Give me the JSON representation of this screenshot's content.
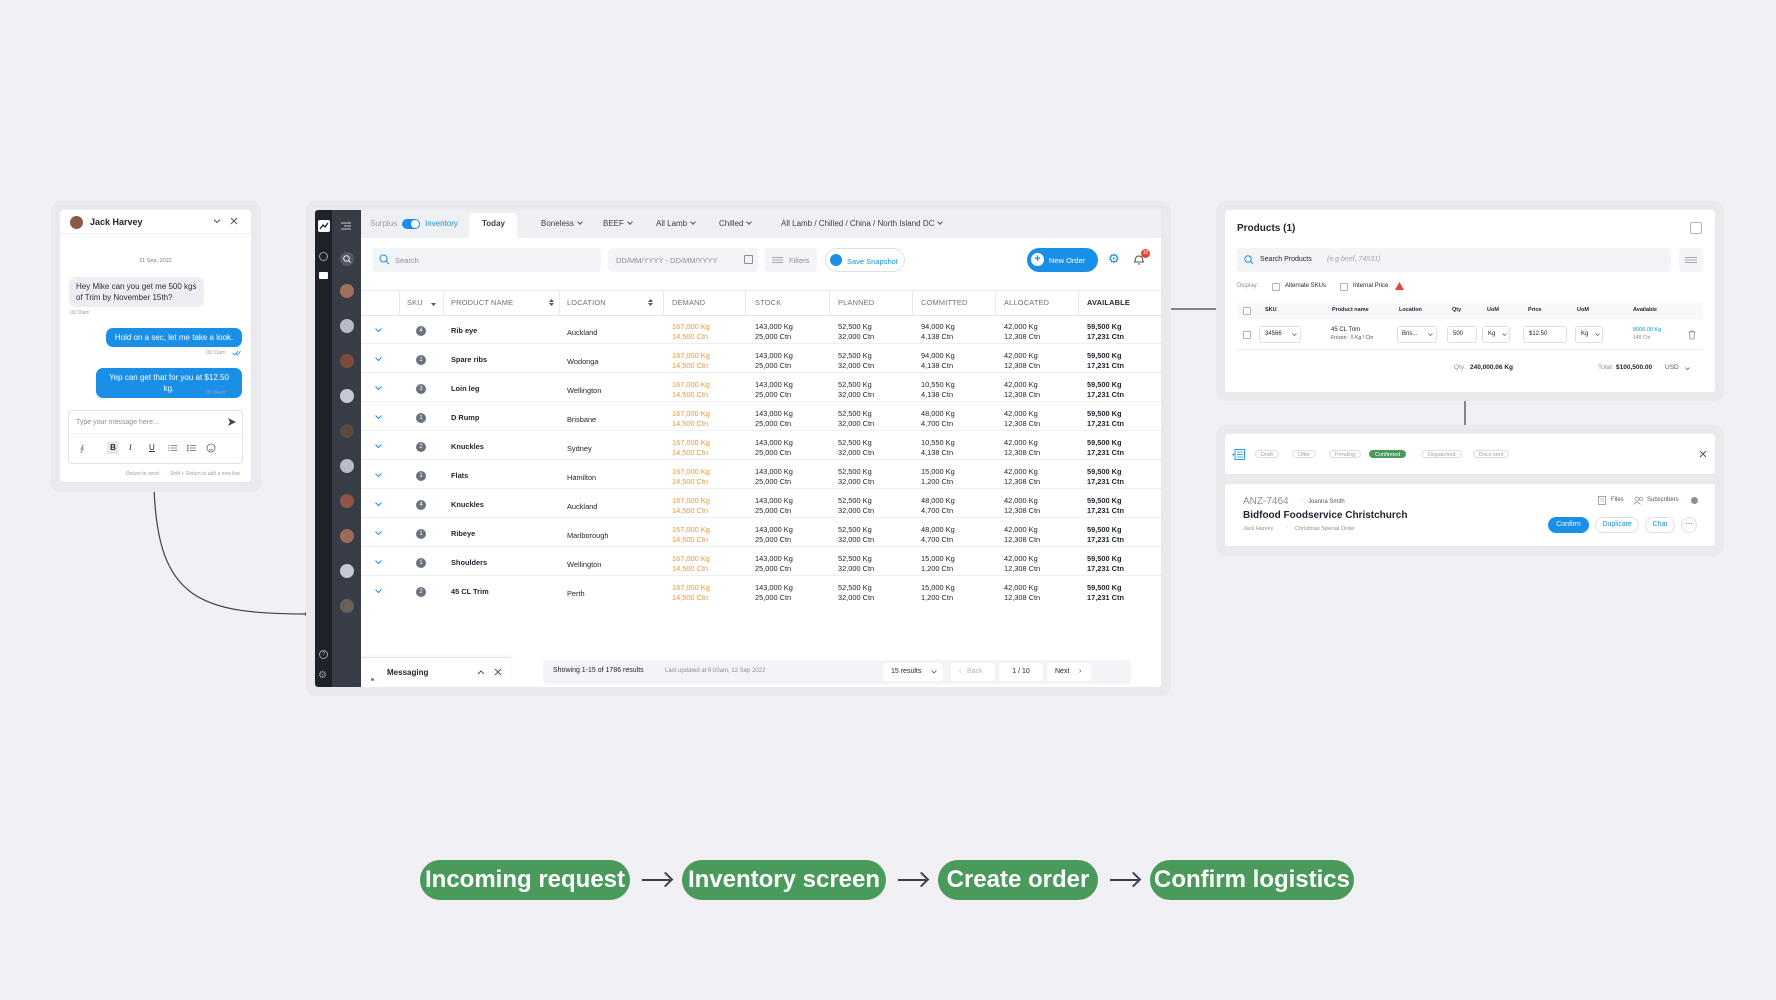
{
  "chat": {
    "name": "Jack Harvey",
    "date": "21 Sep, 2022",
    "messages": [
      {
        "from": "in",
        "text": "Hey Mike can you get me 500 kgs of Trim by November 15th?",
        "time": "09:30am"
      },
      {
        "from": "out",
        "text": "Hold on a sec, let me take a look.",
        "time": "09:31am"
      },
      {
        "from": "out",
        "text": "Yep can get that for you at $12.50 kg.",
        "time": "09:34am"
      }
    ],
    "input_placeholder": "Type your message here...",
    "hint_return": "Return to send",
    "hint_shift": "Shift + Return to add a new line"
  },
  "tabs": {
    "surplus": "Surplus",
    "inventory": "Inventory",
    "today": "Today",
    "filters": [
      "Boneless",
      "BEEF",
      "All Lamb",
      "Chilled",
      "All Lamb / Chilled / China / North Island DC"
    ]
  },
  "toolbar": {
    "search_placeholder": "Search",
    "date_placeholder": "DD/MM/YYYY - DD/MM/YYYY",
    "filters_label": "Filters",
    "save_snapshot": "Save Snapshot",
    "new_order": "New Order",
    "notification_count": "10"
  },
  "table": {
    "columns": [
      "SKU",
      "PRODUCT NAME",
      "LOCATION",
      "DEMAND",
      "STOCK",
      "PLANNED",
      "COMMITTED",
      "ALLOCATED",
      "AVAILABLE"
    ],
    "rows": [
      {
        "sku": "4",
        "name": "Rib eye",
        "location": "Auckland",
        "demand": [
          "167,000  Kg",
          "14,500 Ctn"
        ],
        "stock": [
          "143,000  Kg",
          "25,000 Ctn"
        ],
        "planned": [
          "52,500  Kg",
          "32,000 Ctn"
        ],
        "committed": [
          "94,000 Kg",
          "4,138 Ctn"
        ],
        "allocated": [
          "42,000 Kg",
          "12,308 Ctn"
        ],
        "available": [
          "59,500 Kg",
          "17,231 Ctn"
        ]
      },
      {
        "sku": "1",
        "name": "Spare ribs",
        "location": "Wodonga",
        "demand": [
          "167,000  Kg",
          "14,500 Ctn"
        ],
        "stock": [
          "143,000  Kg",
          "25,000 Ctn"
        ],
        "planned": [
          "52,500  Kg",
          "32,000 Ctn"
        ],
        "committed": [
          "94,000 Kg",
          "4,138 Ctn"
        ],
        "allocated": [
          "42,000 Kg",
          "12,308 Ctn"
        ],
        "available": [
          "59,500 Kg",
          "17,231 Ctn"
        ]
      },
      {
        "sku": "3",
        "name": "Loin leg",
        "location": "Wellington",
        "demand": [
          "167,000  Kg",
          "14,500 Ctn"
        ],
        "stock": [
          "143,000  Kg",
          "25,000 Ctn"
        ],
        "planned": [
          "52,500  Kg",
          "32,000 Ctn"
        ],
        "committed": [
          "10,550 Kg",
          "4,138 Ctn"
        ],
        "allocated": [
          "42,000 Kg",
          "12,308 Ctn"
        ],
        "available": [
          "59,500 Kg",
          "17,231 Ctn"
        ]
      },
      {
        "sku": "1",
        "name": "D Rump",
        "location": "Brisbane",
        "demand": [
          "167,000  Kg",
          "14,500 Ctn"
        ],
        "stock": [
          "143,000  Kg",
          "25,000 Ctn"
        ],
        "planned": [
          "52,500  Kg",
          "32,000 Ctn"
        ],
        "committed": [
          "48,000 Kg",
          "4,700 Ctn"
        ],
        "allocated": [
          "42,000 Kg",
          "12,308 Ctn"
        ],
        "available": [
          "59,500 Kg",
          "17,231 Ctn"
        ]
      },
      {
        "sku": "2",
        "name": "Knuckles",
        "location": "Sydney",
        "demand": [
          "167,000  Kg",
          "14,500 Ctn"
        ],
        "stock": [
          "143,000  Kg",
          "25,000 Ctn"
        ],
        "planned": [
          "52,500  Kg",
          "32,000 Ctn"
        ],
        "committed": [
          "10,550 Kg",
          "4,138 Ctn"
        ],
        "allocated": [
          "42,000 Kg",
          "12,308 Ctn"
        ],
        "available": [
          "59,500 Kg",
          "17,231 Ctn"
        ]
      },
      {
        "sku": "1",
        "name": "Flats",
        "location": "Hamilton",
        "demand": [
          "167,000  Kg",
          "14,500 Ctn"
        ],
        "stock": [
          "143,000  Kg",
          "25,000 Ctn"
        ],
        "planned": [
          "52,500  Kg",
          "32,000 Ctn"
        ],
        "committed": [
          "15,000 Kg",
          "1,200 Ctn"
        ],
        "allocated": [
          "42,000 Kg",
          "12,308 Ctn"
        ],
        "available": [
          "59,500 Kg",
          "17,231 Ctn"
        ]
      },
      {
        "sku": "4",
        "name": "Knuckles",
        "location": "Auckland",
        "demand": [
          "167,000  Kg",
          "14,500 Ctn"
        ],
        "stock": [
          "143,000  Kg",
          "25,000 Ctn"
        ],
        "planned": [
          "52,500  Kg",
          "32,000 Ctn"
        ],
        "committed": [
          "48,000 Kg",
          "4,700 Ctn"
        ],
        "allocated": [
          "42,000 Kg",
          "12,308 Ctn"
        ],
        "available": [
          "59,500 Kg",
          "17,231 Ctn"
        ]
      },
      {
        "sku": "1",
        "name": "Ribeye",
        "location": "Marlborough",
        "demand": [
          "167,000  Kg",
          "14,500 Ctn"
        ],
        "stock": [
          "143,000  Kg",
          "25,000 Ctn"
        ],
        "planned": [
          "52,500  Kg",
          "32,000 Ctn"
        ],
        "committed": [
          "48,000 Kg",
          "4,700 Ctn"
        ],
        "allocated": [
          "42,000 Kg",
          "12,308 Ctn"
        ],
        "available": [
          "59,500 Kg",
          "17,231 Ctn"
        ]
      },
      {
        "sku": "1",
        "name": "Shoulders",
        "location": "Wellington",
        "demand": [
          "167,000  Kg",
          "14,500 Ctn"
        ],
        "stock": [
          "143,000  Kg",
          "25,000 Ctn"
        ],
        "planned": [
          "52,500  Kg",
          "32,000 Ctn"
        ],
        "committed": [
          "15,000 Kg",
          "1,200 Ctn"
        ],
        "allocated": [
          "42,000 Kg",
          "12,308 Ctn"
        ],
        "available": [
          "59,500 Kg",
          "17,231 Ctn"
        ]
      },
      {
        "sku": "2",
        "name": "45  CL Trim",
        "location": "Perth",
        "demand": [
          "167,000  Kg",
          "14,500 Ctn"
        ],
        "stock": [
          "143,000  Kg",
          "25,000 Ctn"
        ],
        "planned": [
          "52,500  Kg",
          "32,000 Ctn"
        ],
        "committed": [
          "15,000 Kg",
          "1,200 Ctn"
        ],
        "allocated": [
          "42,000 Kg",
          "12,308 Ctn"
        ],
        "available": [
          "59,500 Kg",
          "17,231 Ctn"
        ]
      }
    ]
  },
  "footer": {
    "messaging": "Messaging",
    "showing": "Showing 1-15 of 1786 results",
    "updated": "Last updated at 6:00am, 12 Sep 2022",
    "results": "15 results",
    "back": "Back",
    "page": "1 / 10",
    "next": "Next"
  },
  "products": {
    "title": "Products (1)",
    "search_placeholder": "Search Products",
    "search_hint": "(e.g beef, 74531)",
    "display_label": "Display:",
    "alt_skus": "Alternate SKUs",
    "internal_price": "Internal Price",
    "columns": [
      "SKU",
      "Product name",
      "Location",
      "Qty",
      "UoM",
      "Price",
      "UoM",
      "Available"
    ],
    "row": {
      "sku": "34566",
      "product": "45  CL Trim",
      "product_sub": "Frozen - 5 Kg / Ctn",
      "location": "Bris...",
      "qty": "500",
      "uom": "Kg",
      "price": "$12.50",
      "uom2": "Kg",
      "available": "8000.00 Kg",
      "available_sub": "148 Ctn"
    },
    "qty_label": "Qty:",
    "qty_total": "240,000.06 Kg",
    "total_label": "Total:",
    "total_value": "$100,500.00",
    "currency": "USD"
  },
  "order": {
    "stages": [
      "Draft",
      "Offer",
      "Pending",
      "Confirmed",
      "Dispatched",
      "Docs sent"
    ],
    "active_stage": "Confirmed",
    "id": "ANZ-7464",
    "owner": "Joanna Smith",
    "customer": "Bidfood Foodservice Christchurch",
    "contact": "Jack Harvey",
    "tag": "Christmas Special Order",
    "files": "Files",
    "subscribers": "Subscribers",
    "confirm": "Confirm",
    "duplicate": "Duplicate",
    "chat": "Chat"
  },
  "flow": [
    "Incoming request",
    "Inventory screen",
    "Create order",
    "Confirm logistics"
  ],
  "colors": {
    "brand_blue": "#1a8fe8",
    "flow_green": "#4a9a5c",
    "demand_orange": "#f0962e",
    "rail_dark": "#1f2329"
  }
}
